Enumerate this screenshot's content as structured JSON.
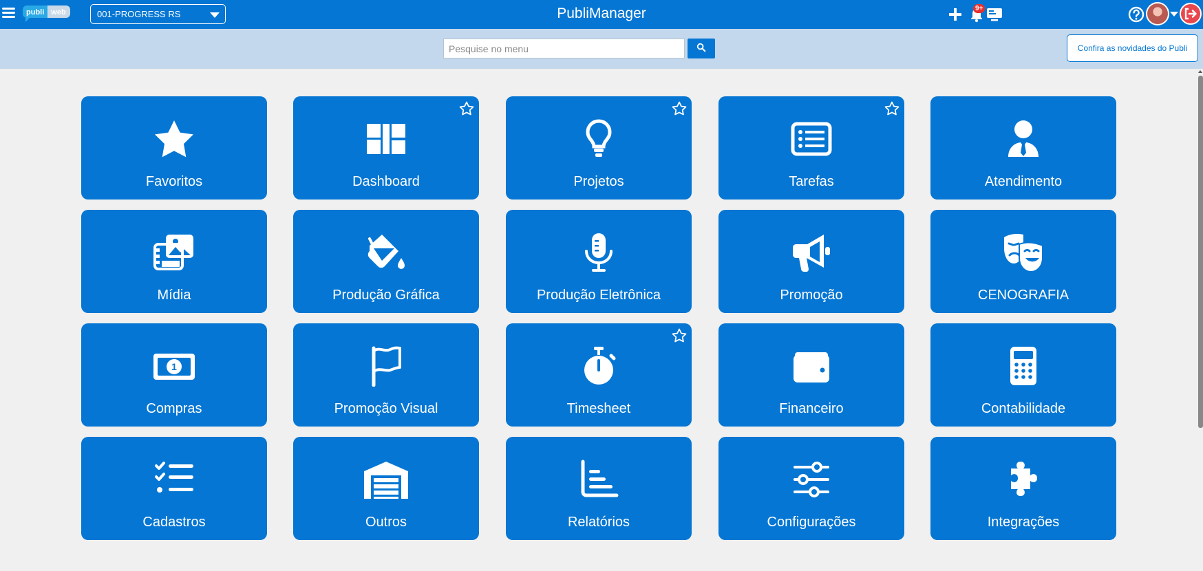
{
  "header": {
    "logo": {
      "part1": "publi",
      "part2": "web"
    },
    "company_select": "001-PROGRESS RS",
    "title": "PubliManager",
    "notifications_badge": "9+",
    "icons": [
      "menu-icon",
      "plus-icon",
      "bell-icon",
      "monitor-icon",
      "help-icon",
      "avatar",
      "logout-icon"
    ]
  },
  "search": {
    "placeholder": "Pesquise no menu",
    "news_label": "Confira as novidades do Publi"
  },
  "colors": {
    "brand": "#0576d3",
    "strip": "#c3d8ed",
    "background": "#f0f0f0",
    "badge": "#e8302d"
  },
  "tiles": [
    {
      "label": "Favoritos",
      "icon": "star-icon",
      "favorite": false
    },
    {
      "label": "Dashboard",
      "icon": "dashboard-icon",
      "favorite": true
    },
    {
      "label": "Projetos",
      "icon": "lightbulb-icon",
      "favorite": true
    },
    {
      "label": "Tarefas",
      "icon": "list-card-icon",
      "favorite": true
    },
    {
      "label": "Atendimento",
      "icon": "person-tie-icon",
      "favorite": false
    },
    {
      "label": "Mídia",
      "icon": "media-icon",
      "favorite": false
    },
    {
      "label": "Produção Gráfica",
      "icon": "paint-bucket-icon",
      "favorite": false
    },
    {
      "label": "Produção Eletrônica",
      "icon": "microphone-icon",
      "favorite": false
    },
    {
      "label": "Promoção",
      "icon": "megaphone-icon",
      "favorite": false
    },
    {
      "label": "CENOGRAFIA",
      "icon": "theater-masks-icon",
      "favorite": false
    },
    {
      "label": "Compras",
      "icon": "money-bill-icon",
      "favorite": false
    },
    {
      "label": "Promoção Visual",
      "icon": "flag-icon",
      "favorite": false
    },
    {
      "label": "Timesheet",
      "icon": "stopwatch-icon",
      "favorite": true
    },
    {
      "label": "Financeiro",
      "icon": "wallet-icon",
      "favorite": false
    },
    {
      "label": "Contabilidade",
      "icon": "calculator-icon",
      "favorite": false
    },
    {
      "label": "Cadastros",
      "icon": "checklist-icon",
      "favorite": false
    },
    {
      "label": "Outros",
      "icon": "warehouse-icon",
      "favorite": false
    },
    {
      "label": "Relatórios",
      "icon": "bar-chart-icon",
      "favorite": false
    },
    {
      "label": "Configurações",
      "icon": "sliders-icon",
      "favorite": false
    },
    {
      "label": "Integrações",
      "icon": "puzzle-icon",
      "favorite": false
    }
  ]
}
